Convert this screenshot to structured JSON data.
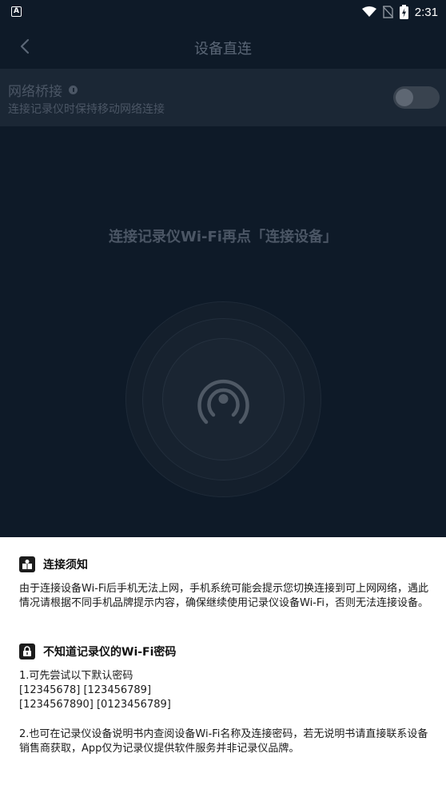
{
  "status_bar": {
    "notification_icon": "A",
    "time": "2:31"
  },
  "header": {
    "title": "设备直连",
    "back_icon": "chevron-left"
  },
  "bridge": {
    "title": "网络桥接",
    "subtitle": "连接记录仪时保持移动网络连接",
    "enabled": false
  },
  "main": {
    "hint": "连接记录仪Wi-Fi再点「连接设备」"
  },
  "notice": {
    "heading": "连接须知",
    "body": "由于连接设备Wi-Fi后手机无法上网，手机系统可能会提示您切换连接到可上网网络，遇此情况请根据不同手机品牌提示内容，确保继续使用记录仪设备Wi-Fi，否则无法连接设备。"
  },
  "password": {
    "heading": "不知道记录仪的Wi-Fi密码",
    "line1": "1.可先尝试以下默认密码",
    "line2": "[12345678] [123456789]",
    "line3": "[1234567890] [0123456789]",
    "line4": "2.也可在记录仪设备说明书内查阅设备Wi-Fi名称及连接密码，若无说明书请直接联系设备销售商获取，App仅为记录仪提供软件服务并非记录仪品牌。"
  },
  "colors": {
    "background": "#0e1a28",
    "panel": "#1b2735",
    "muted_text": "#4b5665"
  }
}
